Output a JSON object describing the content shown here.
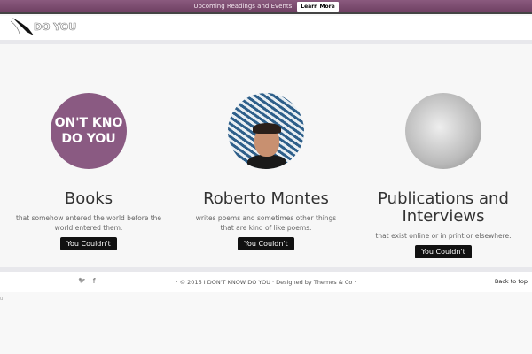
{
  "announcement": {
    "text": "Upcoming Readings and Events",
    "button": "Learn More"
  },
  "logo": {
    "text": "DO YOU"
  },
  "columns": [
    {
      "image_text": [
        "ON'T KNO",
        "DO YOU"
      ],
      "title": "Books",
      "description": "that somehow entered the world before the world entered them.",
      "button": "You Couldn't"
    },
    {
      "title": "Roberto Montes",
      "description": "writes poems and sometimes other things that are kind of like poems.",
      "button": "You Couldn't"
    },
    {
      "title": "Publications and Interviews",
      "description": "that exist online or in print or elsewhere.",
      "button": "You Couldn't"
    }
  ],
  "footer": {
    "copyright": "· © 2015 I DON'T KNOW DO YOU · Designed by Themes & Co ·",
    "back_to_top": "Back to top",
    "twitter": "🐦",
    "facebook": "f"
  },
  "misc": "u"
}
